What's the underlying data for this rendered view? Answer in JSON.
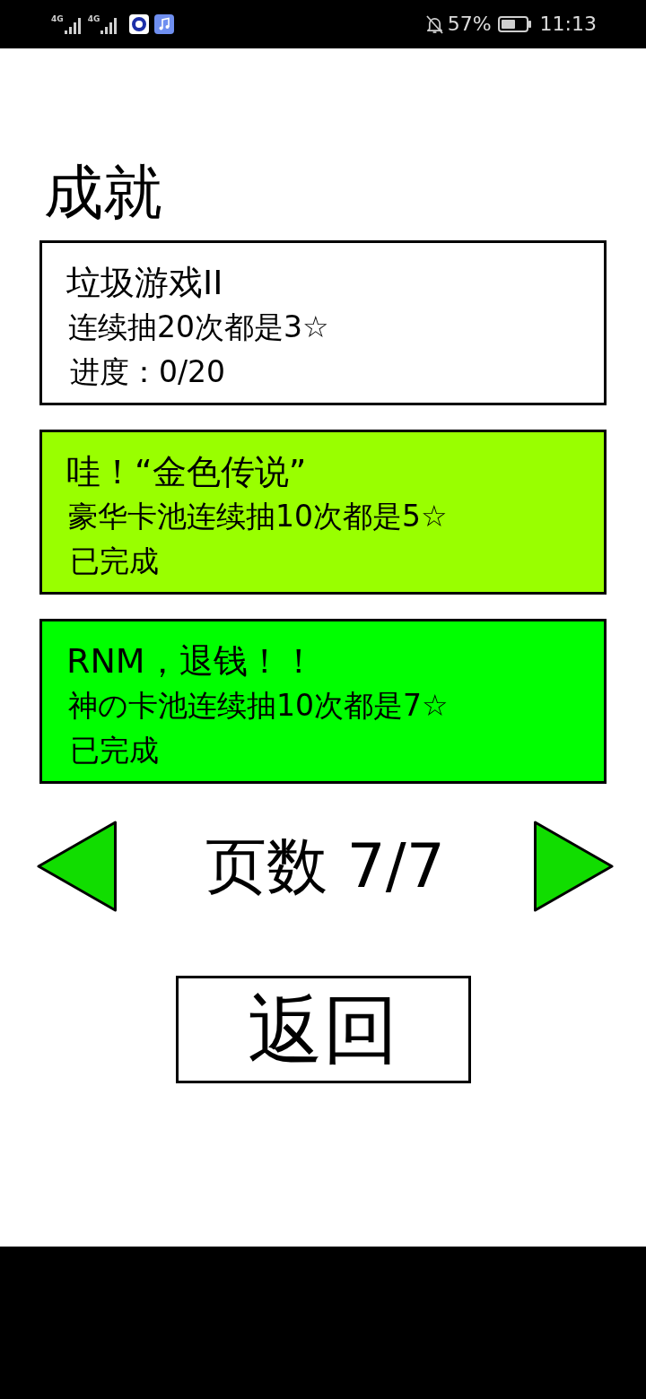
{
  "status_bar": {
    "network_labels": [
      "4G",
      "4G"
    ],
    "battery_percent": "57%",
    "time": "11:13"
  },
  "title": "成就",
  "achievements": [
    {
      "title": "垃圾游戏II",
      "description": "连续抽20次都是3☆",
      "status": "进度：0/20",
      "color": "#ffffff"
    },
    {
      "title": "哇！“金色传说”",
      "description": "豪华卡池连续抽10次都是5☆",
      "status": "已完成",
      "color": "#99ff00"
    },
    {
      "title": "RNM，退钱！！",
      "description": "神の卡池连续抽10次都是7☆",
      "status": "已完成",
      "color": "#00ff00"
    }
  ],
  "pager": {
    "label": "页数 7/7"
  },
  "back_button": {
    "label": "返回"
  }
}
